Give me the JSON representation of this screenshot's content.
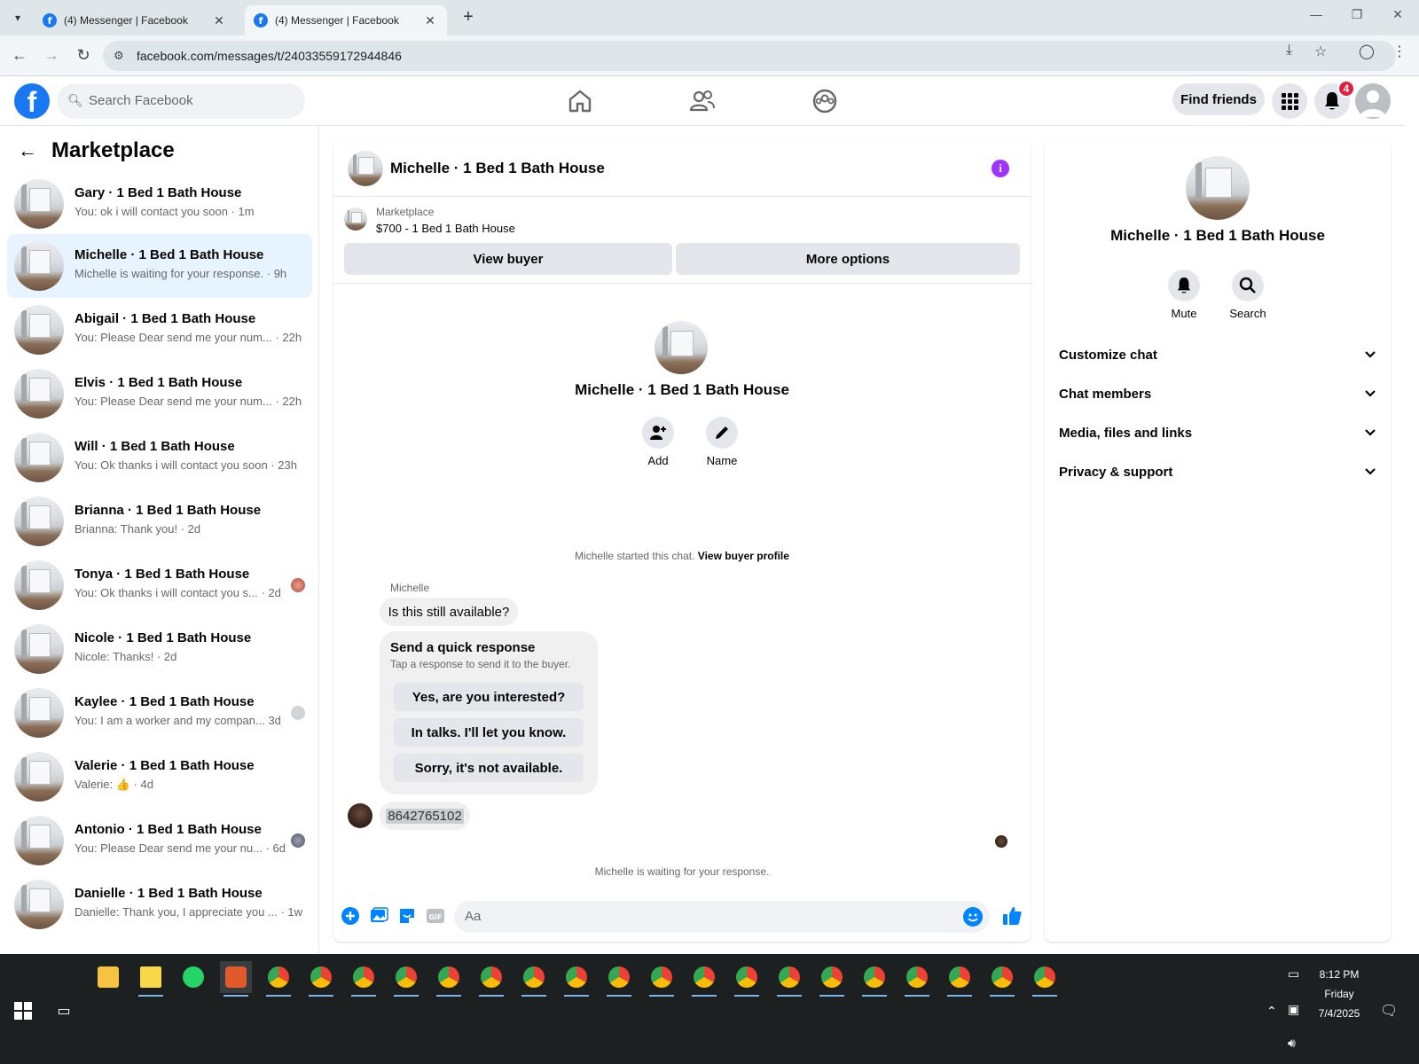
{
  "browser": {
    "tabs": [
      {
        "title": "(4) Messenger | Facebook",
        "active": false
      },
      {
        "title": "(4) Messenger | Facebook",
        "active": true
      }
    ],
    "url": "facebook.com/messages/t/24033559172944846"
  },
  "header": {
    "search_placeholder": "Search Facebook",
    "find_friends": "Find friends",
    "notification_count": "4"
  },
  "sidebar": {
    "title": "Marketplace",
    "conversations": [
      {
        "name": "Gary · 1 Bed 1 Bath House",
        "preview": "You: ok i will contact you soon · 1m",
        "active": false
      },
      {
        "name": "Michelle · 1 Bed 1 Bath House",
        "preview": "Michelle is waiting for your response. · 9h",
        "active": true
      },
      {
        "name": "Abigail · 1 Bed 1 Bath House",
        "preview": "You: Please Dear send me your num...  · 22h"
      },
      {
        "name": "Elvis · 1 Bed 1 Bath House",
        "preview": "You: Please Dear send me your num...  · 22h"
      },
      {
        "name": "Will · 1 Bed 1 Bath House",
        "preview": "You: Ok thanks i will contact you soon · 23h"
      },
      {
        "name": "Brianna · 1 Bed 1 Bath House",
        "preview": "Brianna: Thank you! · 2d"
      },
      {
        "name": "Tonya · 1 Bed 1 Bath House",
        "preview": "You: Ok thanks i will contact you s...  · 2d"
      },
      {
        "name": "Nicole · 1 Bed 1 Bath House",
        "preview": "Nicole: Thanks! · 2d"
      },
      {
        "name": "Kaylee · 1 Bed 1 Bath House",
        "preview": "You: I am a worker and my compan...  3d"
      },
      {
        "name": "Valerie · 1 Bed 1 Bath House",
        "preview": "Valerie: 👍 · 4d"
      },
      {
        "name": "Antonio · 1 Bed 1 Bath House",
        "preview": "You: Please Dear send me your nu...  · 6d"
      },
      {
        "name": "Danielle · 1 Bed 1 Bath House",
        "preview": "Danielle: Thank you, I appreciate you ...  · 1w"
      }
    ]
  },
  "chat": {
    "title": "Michelle · 1 Bed 1 Bath House",
    "listing_label": "Marketplace",
    "listing_price": "$700 - 1 Bed 1 Bath House",
    "view_buyer": "View buyer",
    "more_options": "More options",
    "intro_name": "Michelle · 1 Bed 1 Bath House",
    "add_label": "Add",
    "name_label": "Name",
    "started_text": "Michelle started this chat.",
    "view_profile": "View buyer profile",
    "sender": "Michelle",
    "first_message": "Is this still available?",
    "quick_title": "Send a quick response",
    "quick_sub": "Tap a response to send it to the buyer.",
    "quick_options": [
      "Yes, are you interested?",
      "In talks. I'll let you know.",
      "Sorry, it's not available."
    ],
    "phone_message": "8642765102",
    "waiting": "Michelle is waiting for your response.",
    "composer_placeholder": "Aa"
  },
  "details": {
    "name": "Michelle · 1 Bed 1 Bath House",
    "mute": "Mute",
    "search": "Search",
    "sections": [
      "Customize chat",
      "Chat members",
      "Media, files and links",
      "Privacy & support"
    ]
  },
  "taskbar": {
    "time": "8:12 PM",
    "day": "Friday",
    "date": "7/4/2025"
  },
  "colors": {
    "fb_blue": "#1877f2",
    "active_row": "#e7f3ff",
    "badge_red": "#e41e3f",
    "info_purple": "#a033ff"
  }
}
